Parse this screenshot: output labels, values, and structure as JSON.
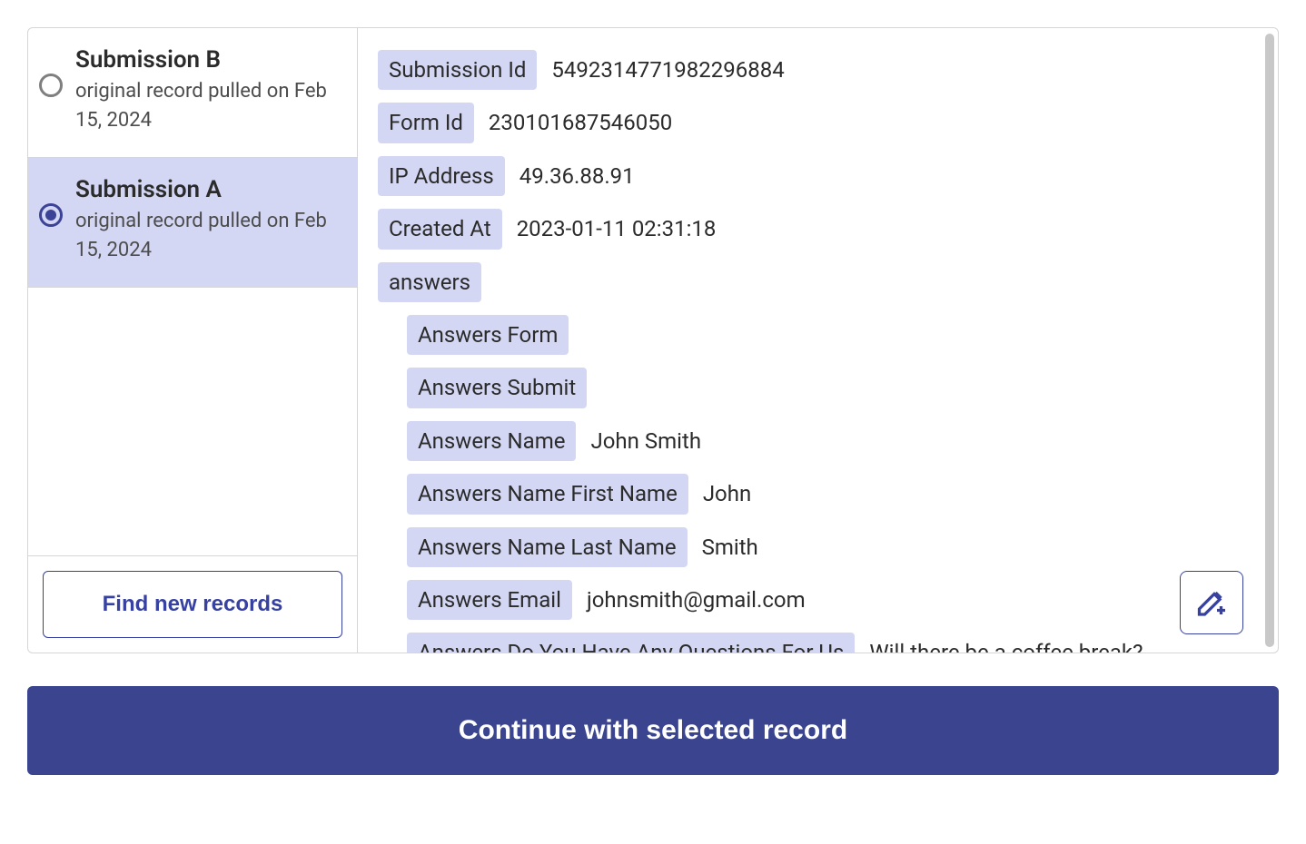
{
  "sidebar": {
    "items": [
      {
        "title": "Submission B",
        "sub": "original record pulled on Feb 15, 2024",
        "selected": false
      },
      {
        "title": "Submission A",
        "sub": "original record pulled on Feb 15, 2024",
        "selected": true
      }
    ],
    "find_label": "Find new records"
  },
  "detail": {
    "fields": [
      {
        "label": "Submission Id",
        "value": "5492314771982296884"
      },
      {
        "label": "Form Id",
        "value": "230101687546050"
      },
      {
        "label": "IP Address",
        "value": "49.36.88.91"
      },
      {
        "label": "Created At",
        "value": "2023-01-11 02:31:18"
      }
    ],
    "answers_label": "answers",
    "answers": [
      {
        "label": "Answers Form",
        "value": ""
      },
      {
        "label": "Answers Submit",
        "value": ""
      },
      {
        "label": "Answers Name",
        "value": "John Smith"
      },
      {
        "label": "Answers Name First Name",
        "value": "John"
      },
      {
        "label": "Answers Name Last Name",
        "value": "Smith"
      },
      {
        "label": "Answers Email",
        "value": "johnsmith@gmail.com"
      },
      {
        "label": "Answers Do You Have Any Questions For Us",
        "value": "Will there be a coffee break?"
      }
    ]
  },
  "continue_label": "Continue with selected record"
}
